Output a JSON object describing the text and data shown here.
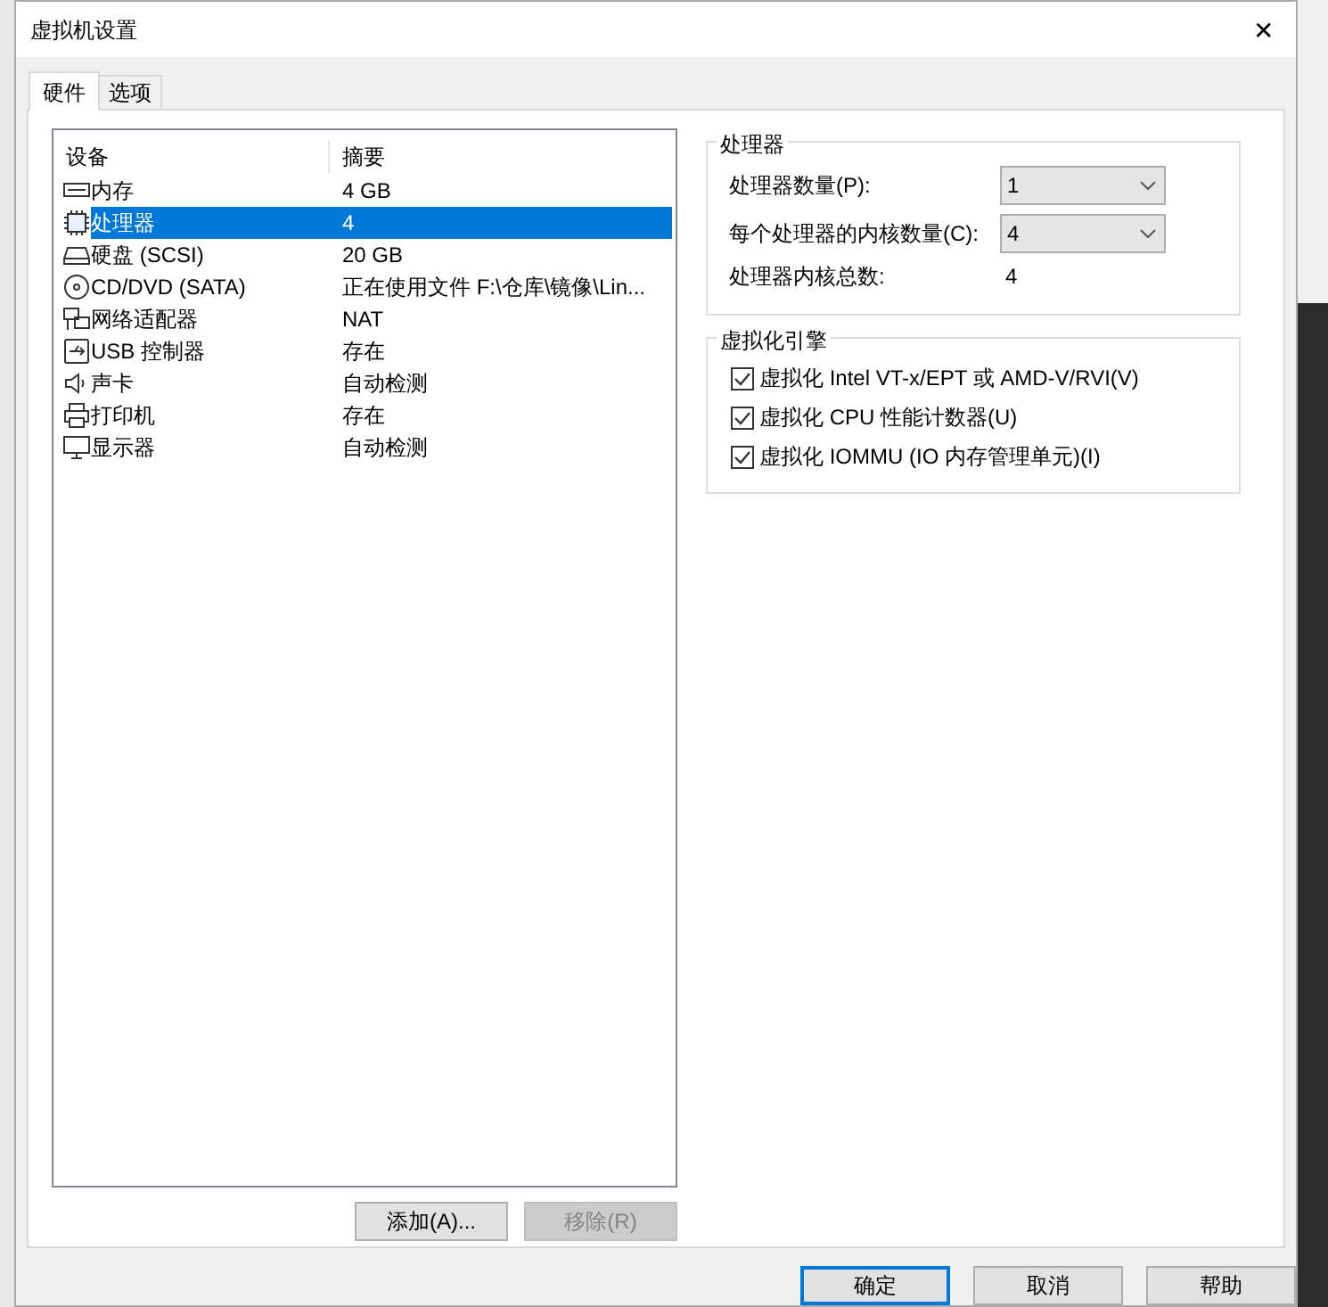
{
  "window": {
    "title": "虚拟机设置",
    "close": "✕"
  },
  "tabs": [
    {
      "label": "硬件",
      "selected": true
    },
    {
      "label": "选项",
      "selected": false
    }
  ],
  "device_list": {
    "columns": [
      "设备",
      "摘要"
    ],
    "rows": [
      {
        "kind": "memory",
        "device": "内存",
        "summary": "4 GB",
        "selected": false
      },
      {
        "kind": "cpu",
        "device": "处理器",
        "summary": "4",
        "selected": true
      },
      {
        "kind": "disk",
        "device": "硬盘 (SCSI)",
        "summary": "20 GB",
        "selected": false
      },
      {
        "kind": "cdrom",
        "device": "CD/DVD (SATA)",
        "summary": "正在使用文件 F:\\仓库\\镜像\\Lin...",
        "selected": false
      },
      {
        "kind": "network",
        "device": "网络适配器",
        "summary": "NAT",
        "selected": false
      },
      {
        "kind": "usb",
        "device": "USB 控制器",
        "summary": "存在",
        "selected": false
      },
      {
        "kind": "sound",
        "device": "声卡",
        "summary": "自动检测",
        "selected": false
      },
      {
        "kind": "printer",
        "device": "打印机",
        "summary": "存在",
        "selected": false
      },
      {
        "kind": "display",
        "device": "显示器",
        "summary": "自动检测",
        "selected": false
      }
    ]
  },
  "list_buttons": [
    {
      "label": "添加(A)...",
      "disabled": false
    },
    {
      "label": "移除(R)",
      "disabled": true
    }
  ],
  "processor_group": {
    "title": "处理器",
    "fields": [
      {
        "label": "处理器数量(P):",
        "value": "1"
      },
      {
        "label": "每个处理器的内核数量(C):",
        "value": "4"
      }
    ],
    "total_label": "处理器内核总数:",
    "total_value": "4"
  },
  "virtualization_group": {
    "title": "虚拟化引擎",
    "options": [
      {
        "label": "虚拟化 Intel VT-x/EPT 或 AMD-V/RVI(V)",
        "checked": true
      },
      {
        "label": "虚拟化 CPU 性能计数器(U)",
        "checked": true
      },
      {
        "label": "虚拟化 IOMMU (IO 内存管理单元)(I)",
        "checked": true
      }
    ]
  },
  "dialog_buttons": [
    {
      "label": "确定",
      "default": true
    },
    {
      "label": "取消",
      "default": false
    },
    {
      "label": "帮助",
      "default": false
    }
  ]
}
